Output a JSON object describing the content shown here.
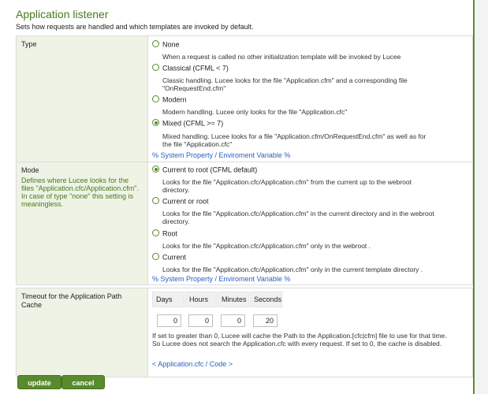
{
  "header": {
    "title": "Application listener",
    "subtitle": "Sets how requests are handled and which templates are invoked by default."
  },
  "type_section": {
    "label": "Type",
    "options": [
      {
        "label": "None",
        "checked": false,
        "desc": "When a request is called no other initialization template will be invoked by Lucee"
      },
      {
        "label": "Classical (CFML < 7)",
        "checked": false,
        "desc": "Classic handling. Lucee looks for the file \"Application.cfm\" and a corresponding file \"OnRequestEnd.cfm\""
      },
      {
        "label": "Modern",
        "checked": false,
        "desc": "Modern handling. Lucee only looks for the file \"Application.cfc\""
      },
      {
        "label": "Mixed (CFML >= 7)",
        "checked": true,
        "desc": "Mixed handling. Lucee looks for a file \"Application.cfm/OnRequestEnd.cfm\" as well as for the file \"Application.cfc\""
      }
    ],
    "link": "% System Property / Enviroment Variable %"
  },
  "mode_section": {
    "label": "Mode",
    "desc": "Defines where Lucee looks for the files \"Application.cfc/Application.cfm\". In case of type \"none\" this setting is meaningless.",
    "options": [
      {
        "label": "Current to root (CFML default)",
        "checked": true,
        "desc": "Looks for the file \"Application.cfc/Application.cfm\" from the current up to the webroot directory."
      },
      {
        "label": "Current or root",
        "checked": false,
        "desc": "Looks for the file \"Application.cfc/Application.cfm\" in the current directory and in the webroot directory."
      },
      {
        "label": "Root",
        "checked": false,
        "desc": "Looks for the file \"Application.cfc/Application.cfm\" only in the webroot ."
      },
      {
        "label": "Current",
        "checked": false,
        "desc": "Looks for the file \"Application.cfc/Application.cfm\" only in the current template directory ."
      }
    ],
    "link": "% System Property / Enviroment Variable %"
  },
  "timeout_section": {
    "label": "Timeout for the Application Path Cache",
    "headers": [
      "Days",
      "Hours",
      "Minutes",
      "Seconds"
    ],
    "values": [
      "0",
      "0",
      "0",
      "20"
    ],
    "desc": "If set to greater than 0, Lucee will cache the Path to the Application.[cfc|cfm] file to use for that time. So Lucee does not search the Application.cfc with every request. If set to 0, the cache is disabled.",
    "link": "< Application.cfc / Code >"
  },
  "buttons": {
    "update": "update",
    "cancel": "cancel"
  },
  "colors": {
    "accent": "#5a8a2e",
    "label_bg": "#eef3e6",
    "link": "#2a5fbf"
  }
}
